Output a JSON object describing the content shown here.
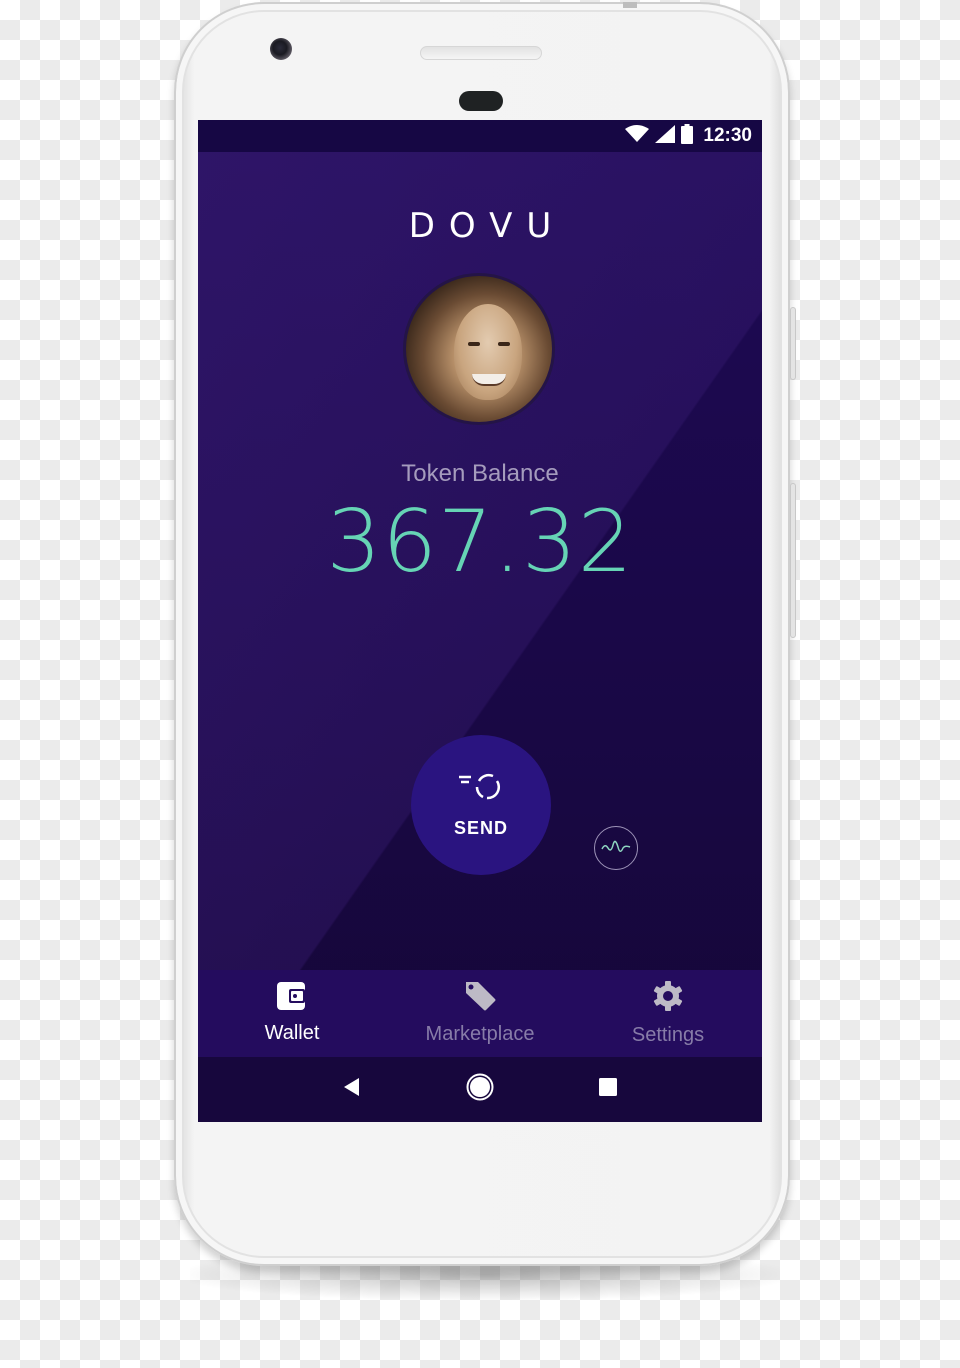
{
  "status_bar": {
    "time": "12:30",
    "icons": [
      "wifi-icon",
      "cellular-signal-icon",
      "battery-icon"
    ]
  },
  "app": {
    "logo_text": "DOVU"
  },
  "profile": {
    "avatar_alt": "User profile photo"
  },
  "balance": {
    "label": "Token Balance",
    "value": "367.32"
  },
  "actions": {
    "send_label": "SEND",
    "send_icon": "send-icon",
    "activity_icon": "activity-wave-icon"
  },
  "tabs": [
    {
      "label": "Wallet",
      "icon": "wallet-icon",
      "active": true
    },
    {
      "label": "Marketplace",
      "icon": "tag-icon",
      "active": false
    },
    {
      "label": "Settings",
      "icon": "gear-icon",
      "active": false
    }
  ],
  "system_nav": {
    "back": "back-icon",
    "home": "home-icon",
    "recents": "recents-icon"
  },
  "colors": {
    "background": "#1a0848",
    "accent_balance": "#66d4b5",
    "send_button": "#2a1480",
    "tab_bar": "#240c5e",
    "tab_active": "#ffffff",
    "tab_inactive": "#877ca8"
  }
}
